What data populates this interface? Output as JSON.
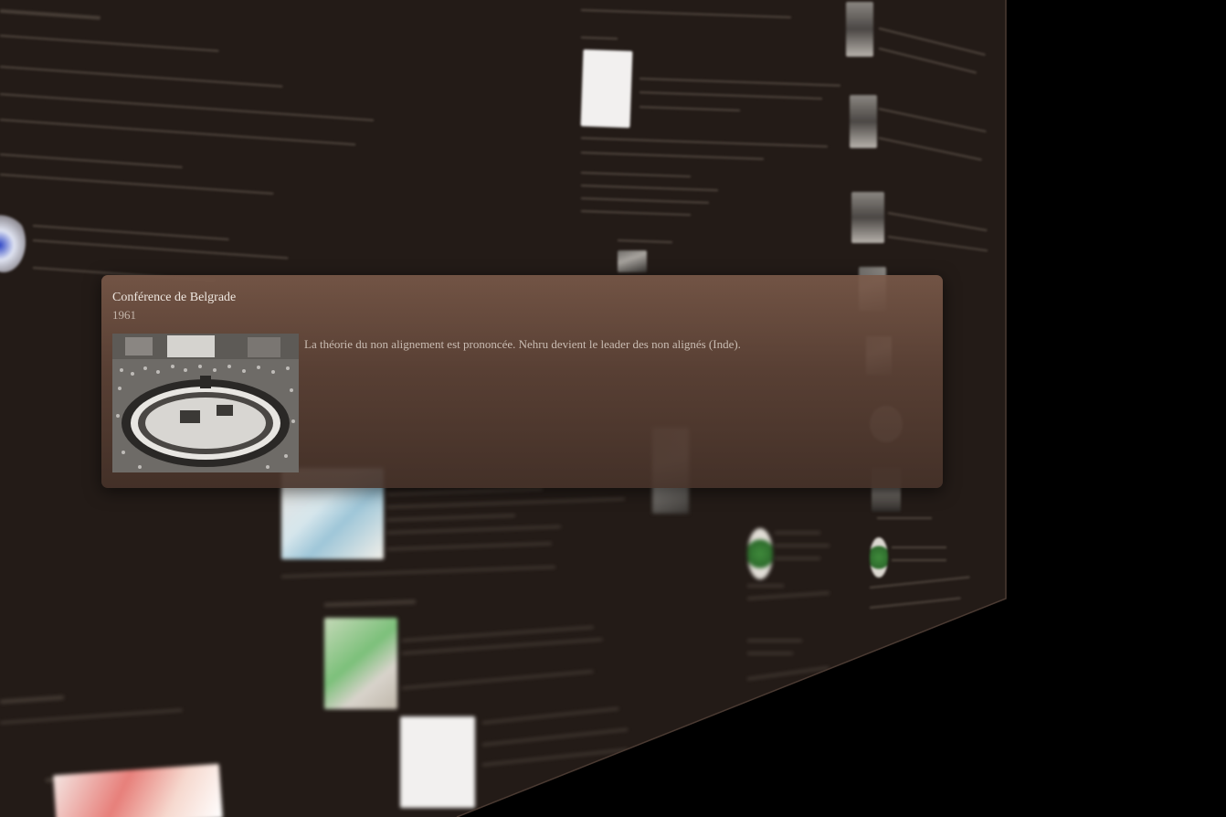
{
  "popup": {
    "title": "Conférence de Belgrade",
    "date": "1961",
    "description": "La théorie du non alignement est prononcée. Nehru devient le leader des non alignés (Inde).",
    "image_alt": "Photo of a large circular conference table in a hall"
  },
  "colors": {
    "background": "#000000",
    "wall": "#231b17",
    "card_top": "#785848",
    "card_bottom": "#46322a"
  },
  "icons": {
    "popup_image": "conference-photo-icon"
  }
}
